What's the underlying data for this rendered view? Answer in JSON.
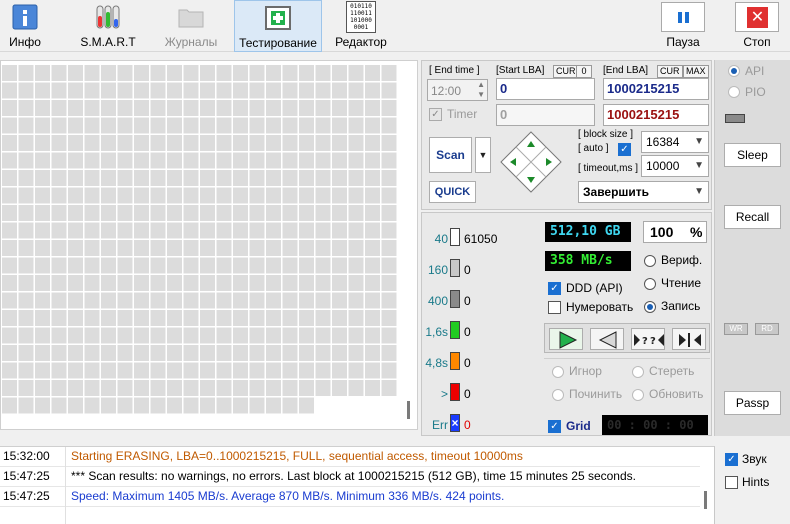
{
  "toolbar": {
    "info": "Инфо",
    "smart": "S.M.A.R.T",
    "logs": "Журналы",
    "testing": "Тестирование",
    "editor": "Редактор",
    "pause": "Пауза",
    "stop": "Стоп",
    "editor_icon_text": [
      "010110",
      "110011",
      "101000",
      "0001"
    ]
  },
  "map": {
    "rows": 20,
    "cols": 24,
    "last_row_cols": 19
  },
  "controls": {
    "end_time_label": "[ End time ]",
    "end_time_value": "12:00",
    "timer_label": "Timer",
    "start_lba_label": "[Start LBA]",
    "start_lba_cur": "CUR",
    "start_lba_cur_value": "0",
    "start_lba_value": "0",
    "start_lba_secondary": "0",
    "end_lba_label": "[End LBA]",
    "end_lba_cur": "CUR",
    "end_lba_max": "MAX",
    "end_lba_value": "1000215215",
    "end_lba_secondary": "1000215215",
    "scan_label": "Scan",
    "quick_label": "QUICK",
    "block_size_label": "[ block size ]",
    "auto_label": "[ auto ]",
    "timeout_label": "[ timeout,ms ]",
    "block_size_value": "16384",
    "timeout_value": "10000",
    "finish_value": "Завершить"
  },
  "stats": {
    "legend": [
      {
        "name": "40",
        "count": "61050",
        "color": "#ffffff"
      },
      {
        "name": "160",
        "count": "0",
        "color": "#c8c8c8"
      },
      {
        "name": "400",
        "count": "0",
        "color": "#8a8a8a"
      },
      {
        "name": "1,6s",
        "count": "0",
        "color": "#22cc22"
      },
      {
        "name": "4,8s",
        "count": "0",
        "color": "#ff8800"
      },
      {
        "name": ">",
        "count": "0",
        "color": "#ee0000"
      },
      {
        "name": "Err",
        "count": "0",
        "color": "#1a3cff"
      }
    ],
    "capacity": "512,10 GB",
    "percent": "100",
    "percent_unit": "%",
    "speed": "358 MB/s",
    "verify": "Вериф.",
    "read": "Чтение",
    "write": "Запись",
    "ddd": "DDD (API)",
    "numerate": "Нумеровать",
    "ignore": "Игнор",
    "erase": "Стереть",
    "repair": "Починить",
    "refresh": "Обновить",
    "grid": "Grid",
    "timer_display": "00 : 00 : 00"
  },
  "right": {
    "api": "API",
    "pio": "PIO",
    "sleep": "Sleep",
    "recall": "Recall",
    "passp": "Passp",
    "wr": "WR",
    "rd": "RD"
  },
  "log": [
    {
      "time": "15:32:00",
      "msg": "Starting ERASING, LBA=0..1000215215, FULL, sequential access, timeout 10000ms",
      "color": "#c05a00"
    },
    {
      "time": "15:47:25",
      "msg": "*** Scan results: no warnings, no errors. Last block at 1000215215 (512 GB), time 15 minutes 25 seconds.",
      "color": "#000000"
    },
    {
      "time": "15:47:25",
      "msg": "Speed: Maximum 1405 MB/s. Average 870 MB/s. Minimum 336 MB/s. 424 points.",
      "color": "#1a3cd0"
    }
  ],
  "log_options": {
    "sound": "Звук",
    "hints": "Hints"
  }
}
